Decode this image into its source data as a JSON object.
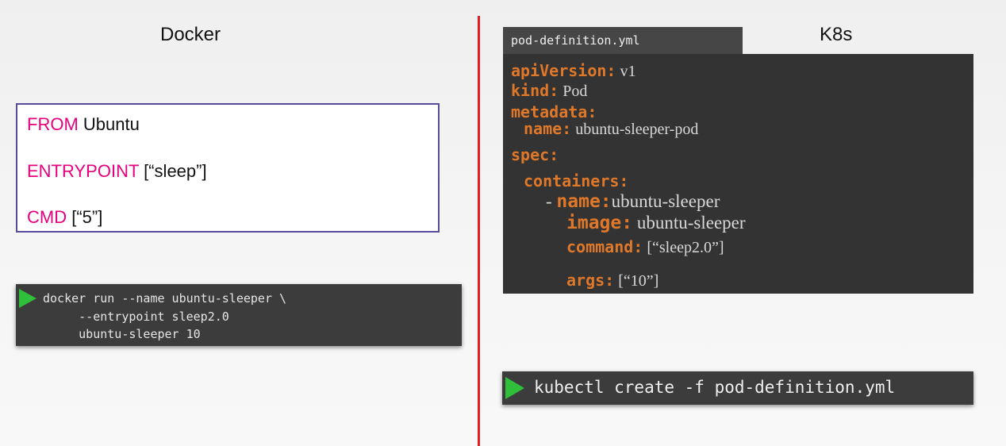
{
  "headings": {
    "docker": "Docker",
    "k8s": "K8s"
  },
  "dockerfile": {
    "lines": [
      {
        "keyword": "FROM",
        "value": " Ubuntu"
      },
      {
        "keyword": "ENTRYPOINT",
        "value": " [“sleep”]"
      },
      {
        "keyword": "CMD",
        "value": " [“5”]"
      }
    ]
  },
  "docker_terminal": {
    "lines": [
      "docker run --name ubuntu-sleeper \\",
      "     --entrypoint sleep2.0",
      "     ubuntu-sleeper 10"
    ]
  },
  "pod_file": {
    "tab_label": "pod-definition.yml",
    "lines": [
      {
        "key": "apiVersion:",
        "value": " v1"
      },
      {
        "key": "kind:",
        "value": " Pod"
      },
      {
        "key": "metadata:",
        "value": ""
      },
      {
        "key": "name:",
        "value": " ubuntu-sleeper-pod"
      },
      {
        "key": "spec:",
        "value": ""
      },
      {
        "key": "containers:",
        "value": ""
      },
      {
        "prefix": "- ",
        "key": "name:",
        "value": "ubuntu-sleeper"
      },
      {
        "key": "image:",
        "value": " ubuntu-sleeper"
      },
      {
        "key": "command:",
        "value": " [“sleep2.0”]"
      },
      {
        "key": "args:",
        "value": " [“10”]"
      }
    ]
  },
  "kubectl_terminal": {
    "command": "kubectl create -f pod-definition.yml"
  },
  "colors": {
    "divider": "#e02020",
    "dockerfile_keyword": "#e6007e",
    "yaml_key": "#e0782a",
    "play_icon": "#2fbf3a",
    "terminal_bg": "#3c3c3c",
    "yaml_bg": "#333333"
  }
}
